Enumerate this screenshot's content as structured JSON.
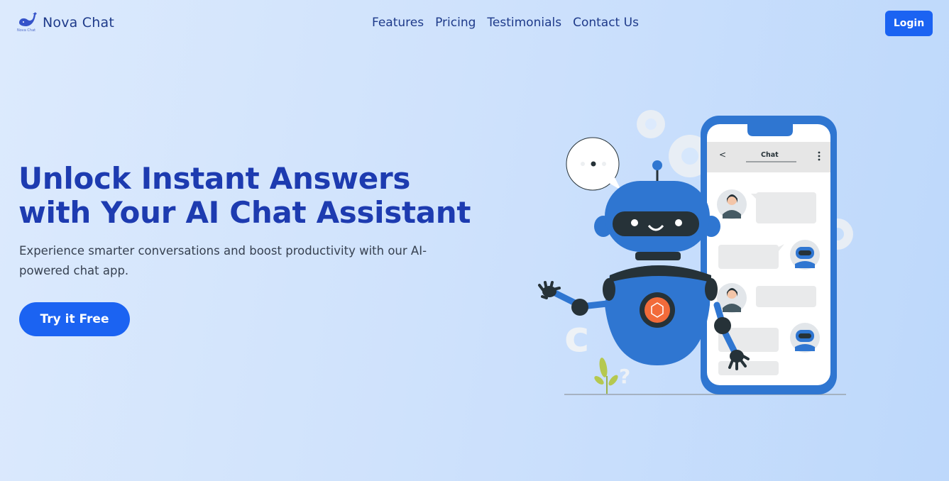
{
  "header": {
    "brand_name": "Nova Chat",
    "logo_caption": "Nova Chat",
    "nav_items": [
      {
        "label": "Features"
      },
      {
        "label": "Pricing"
      },
      {
        "label": "Testimonials"
      },
      {
        "label": "Contact Us"
      }
    ],
    "login_label": "Login"
  },
  "hero": {
    "title": "Unlock Instant Answers with Your AI Chat Assistant",
    "subtitle": "Experience smarter conversations and boost productivity with our AI-powered chat app.",
    "cta_label": "Try it Free"
  },
  "illustration": {
    "phone_header_title": "Chat",
    "back_glyph": "<"
  },
  "colors": {
    "primary": "#1b63f2",
    "title": "#1d3bb0",
    "robot_blue": "#2f76d1",
    "robot_dark": "#263238",
    "accent_orange": "#f26b3a"
  }
}
